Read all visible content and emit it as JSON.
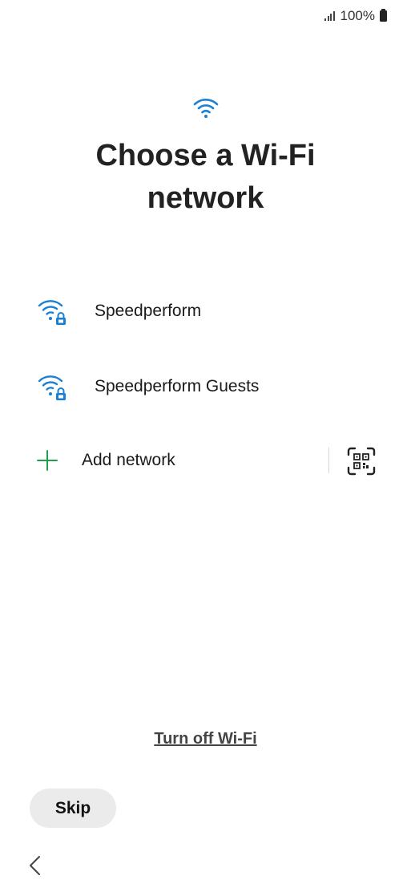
{
  "status_bar": {
    "battery_text": "100%",
    "icons": [
      "signal-icon",
      "battery-icon"
    ]
  },
  "header": {
    "icon": "wifi-icon",
    "title_line1": "Choose a Wi-Fi",
    "title_line2": "network"
  },
  "networks": [
    {
      "name": "Speedperform",
      "icon": "wifi-locked-icon"
    },
    {
      "name": "Speedperform Guests",
      "icon": "wifi-locked-icon"
    }
  ],
  "add_network": {
    "label": "Add network",
    "icon": "plus-icon",
    "qr_icon": "qr-code-scan-icon"
  },
  "turn_off_label": "Turn off Wi-Fi",
  "skip_label": "Skip",
  "nav": {
    "back_icon": "chevron-left-icon"
  },
  "colors": {
    "wifi_blue": "#1a7fd6",
    "plus_green": "#1fa04a"
  }
}
